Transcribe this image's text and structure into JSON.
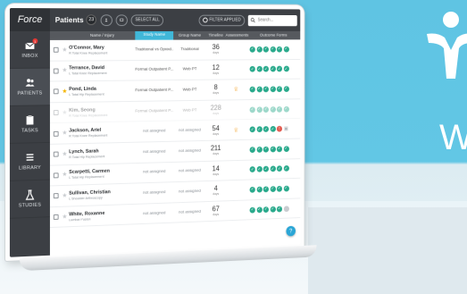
{
  "brand": {
    "word": "W"
  },
  "app": {
    "logo": "Force",
    "title": "Patients",
    "count": "23",
    "select_all": "SELECT ALL",
    "filter": "FILTER APPLIED",
    "search_placeholder": "Search..."
  },
  "sidebar": {
    "items": [
      {
        "label": "INBOX",
        "icon": "inbox-icon",
        "badge": "1"
      },
      {
        "label": "PATIENTS",
        "icon": "patients-icon"
      },
      {
        "label": "TASKS",
        "icon": "tasks-icon"
      },
      {
        "label": "LIBRARY",
        "icon": "library-icon"
      },
      {
        "label": "STUDIES",
        "icon": "studies-icon"
      }
    ]
  },
  "table": {
    "columns": [
      "Name / Injury",
      "Study Name",
      "Group Name",
      "Timeline",
      "Assessments",
      "Outcome Forms"
    ],
    "rows": [
      {
        "name": "O'Connor, Mary",
        "injury": "R Total Knee Replacement",
        "study": "Traditional vs Opioid...",
        "group": "Traditional",
        "timeline": "36",
        "unit": "days",
        "starred": false,
        "assess": false,
        "forms": [
          "g",
          "g",
          "g",
          "g",
          "g",
          "g"
        ]
      },
      {
        "name": "Terrance, David",
        "injury": "L Total Knee Replacement",
        "study": "Formal Outpatient P...",
        "group": "Web PT",
        "timeline": "12",
        "unit": "days",
        "starred": false,
        "assess": false,
        "forms": [
          "g",
          "g",
          "g",
          "g",
          "g",
          "g"
        ]
      },
      {
        "name": "Pond, Linda",
        "injury": "L Total Hip Replacement",
        "study": "Formal Outpatient P...",
        "group": "Web PT",
        "timeline": "8",
        "unit": "days",
        "starred": true,
        "assess": true,
        "forms": [
          "g",
          "g",
          "g",
          "g",
          "g",
          "g"
        ]
      },
      {
        "name": "Kim, Seong",
        "injury": "R Total Knee Replacement",
        "study": "Formal Outpatient P...",
        "group": "Web PT",
        "timeline": "228",
        "unit": "days",
        "starred": false,
        "assess": false,
        "faded": true,
        "forms": [
          "g",
          "g",
          "g",
          "g",
          "g",
          "g"
        ]
      },
      {
        "name": "Jackson, Ariel",
        "injury": "R Total Knee Replacement",
        "study": "not assigned",
        "group": "not assigned",
        "timeline": "54",
        "unit": "days",
        "starred": false,
        "assess": true,
        "forms": [
          "g",
          "g",
          "g",
          "g",
          "r",
          "l"
        ]
      },
      {
        "name": "Lynch, Sarah",
        "injury": "R Total Hip Replacement",
        "study": "not assigned",
        "group": "not assigned",
        "timeline": "211",
        "unit": "days",
        "starred": false,
        "assess": false,
        "forms": [
          "g",
          "g",
          "g",
          "g",
          "g",
          "g"
        ]
      },
      {
        "name": "Scarpetti, Carmen",
        "injury": "L Total Hip Replacement",
        "study": "not assigned",
        "group": "not assigned",
        "timeline": "14",
        "unit": "days",
        "starred": false,
        "assess": false,
        "forms": [
          "g",
          "g",
          "g",
          "g",
          "g",
          "g"
        ]
      },
      {
        "name": "Sullivan, Christian",
        "injury": "L Shoulder Arthroscopy",
        "study": "not assigned",
        "group": "not assigned",
        "timeline": "4",
        "unit": "days",
        "starred": false,
        "assess": false,
        "forms": [
          "g",
          "g",
          "g",
          "g",
          "g",
          "g"
        ]
      },
      {
        "name": "White, Roxanne",
        "injury": "Lumbar Fusion",
        "study": "not assigned",
        "group": "not assigned",
        "timeline": "67",
        "unit": "days",
        "starred": false,
        "assess": false,
        "forms": [
          "g",
          "g",
          "g",
          "g",
          "g",
          "x"
        ]
      }
    ]
  },
  "help_label": "?"
}
